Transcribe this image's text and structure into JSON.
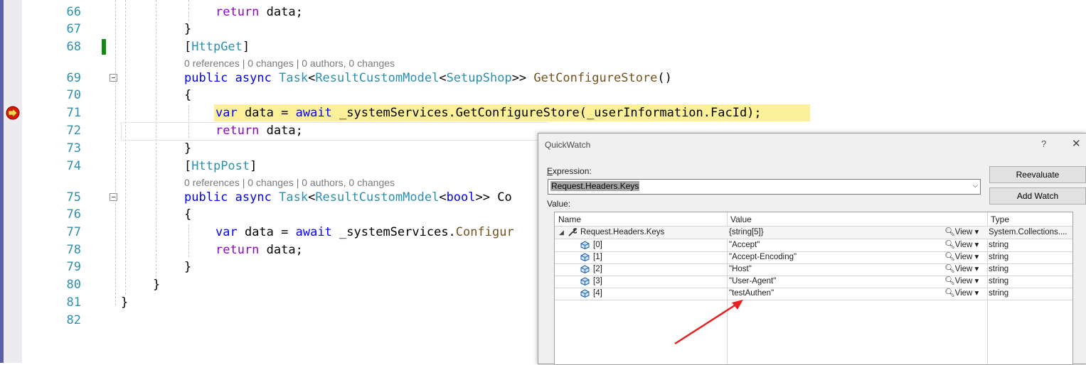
{
  "editor": {
    "line_numbers": [
      "66",
      "67",
      "68",
      "69",
      "70",
      "71",
      "72",
      "73",
      "74",
      "75",
      "76",
      "77",
      "78",
      "79",
      "80",
      "81",
      "82"
    ],
    "code": {
      "l66_kw": "return",
      "l66_rest": " data;",
      "l67": "}",
      "l68_open": "[",
      "l68_attr": "HttpGet",
      "l68_close": "]",
      "lens1": "0 references | 0 changes | 0 authors, 0 changes",
      "l69_kw1": "public",
      "l69_kw2": "async",
      "l69_t1": "Task",
      "l69_t2": "ResultCustomModel",
      "l69_t3": "SetupShop",
      "l69_fn": "GetConfigureStore",
      "l69_tail": "()",
      "l70": "{",
      "l71_kw1": "var",
      "l71_mid": " data = ",
      "l71_kw2": "await",
      "l71_rest": " _systemServices.GetConfigureStore(_userInformation.FacId);",
      "l72_kw": "return",
      "l72_rest": " data;",
      "l73": "}",
      "l74_open": "[",
      "l74_attr": "HttpPost",
      "l74_close": "]",
      "lens2": "0 references | 0 changes | 0 authors, 0 changes",
      "l75_kw1": "public",
      "l75_kw2": "async",
      "l75_t1": "Task",
      "l75_t2": "ResultCustomModel",
      "l75_kw3": "bool",
      "l75_tail": ">> Co",
      "l76": "{",
      "l77_kw1": "var",
      "l77_mid": " data = ",
      "l77_kw2": "await",
      "l77_rest": " _systemServices.",
      "l77_fn": "Configur",
      "l78_kw": "return",
      "l78_rest": " data;",
      "l79": "}",
      "l80": "}",
      "l81": "}"
    }
  },
  "quickwatch": {
    "title": "QuickWatch",
    "help": "?",
    "close": "✕",
    "expression_label": "Expression:",
    "expression": "Request.Headers.Keys",
    "reevaluate": "Reevaluate",
    "add_watch": "Add Watch",
    "value_label": "Value:",
    "columns": {
      "name": "Name",
      "value": "Value",
      "type": "Type"
    },
    "view_label": "View",
    "rows": [
      {
        "name": "Request.Headers.Keys",
        "value": "{string[5]}",
        "type": "System.Collections...."
      },
      {
        "name": "[0]",
        "value": "\"Accept\"",
        "type": "string"
      },
      {
        "name": "[1]",
        "value": "\"Accept-Encoding\"",
        "type": "string"
      },
      {
        "name": "[2]",
        "value": "\"Host\"",
        "type": "string"
      },
      {
        "name": "[3]",
        "value": "\"User-Agent\"",
        "type": "string"
      },
      {
        "name": "[4]",
        "value": "\"testAuthen\"",
        "type": "string"
      }
    ]
  },
  "colors": {
    "keyword": "#0000ff",
    "control": "#8f08c4",
    "type": "#2b91af",
    "highlight": "#fbf097",
    "annotation": "#e82020"
  }
}
